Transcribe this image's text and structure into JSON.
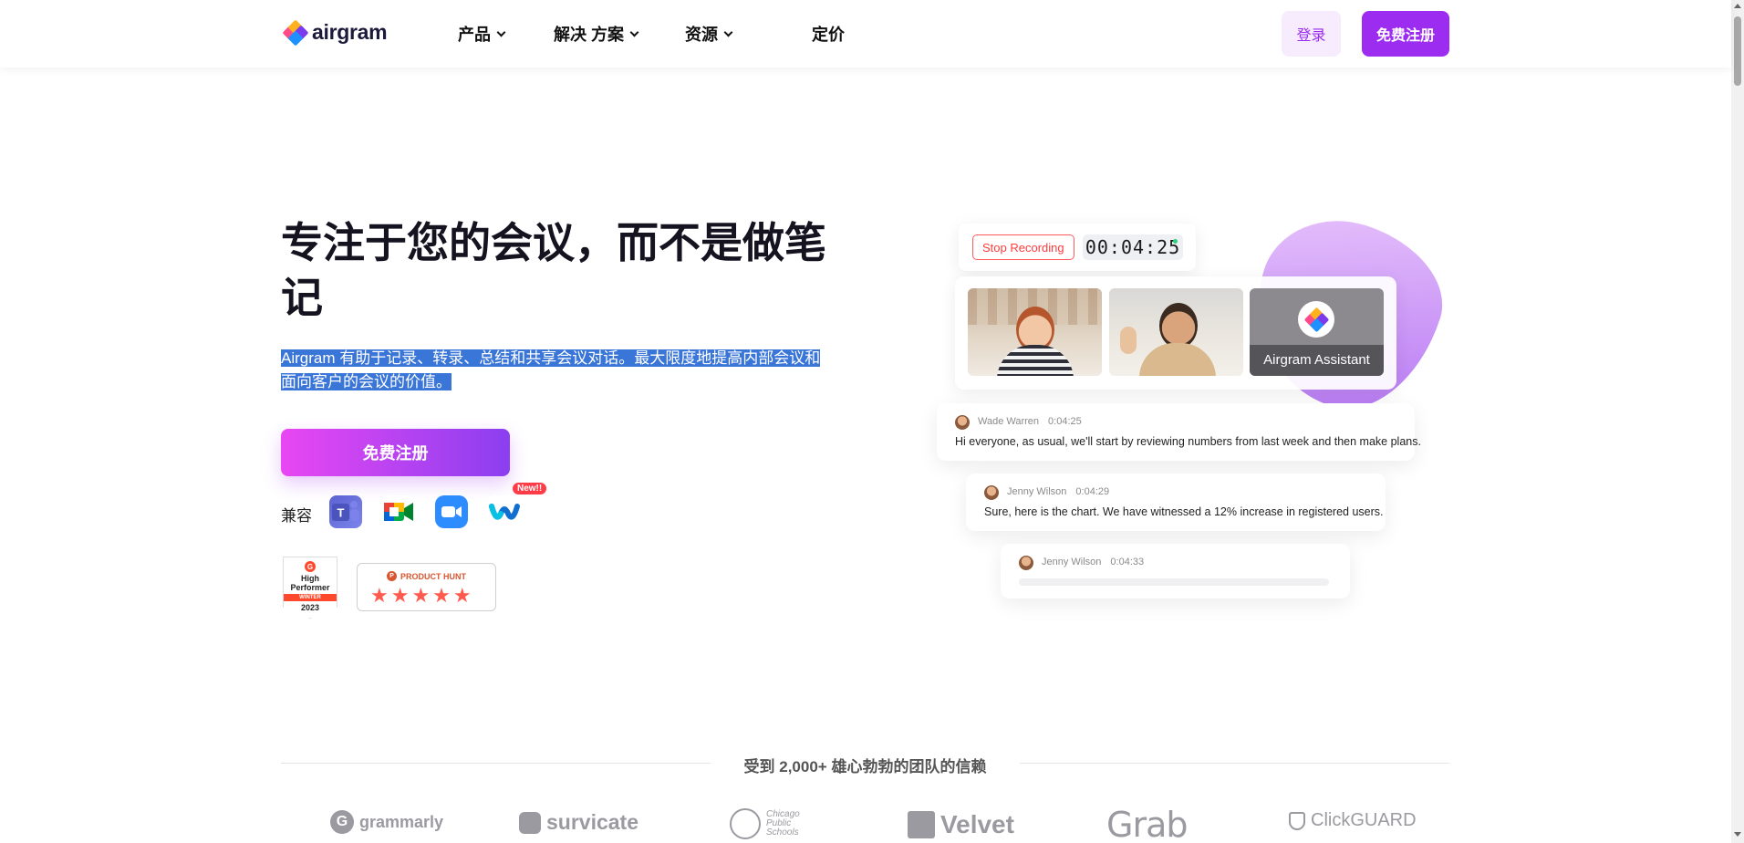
{
  "header": {
    "logo_text": "airgram",
    "nav": [
      {
        "label": "产品",
        "has_dropdown": true
      },
      {
        "label": "解决 方案",
        "has_dropdown": true
      },
      {
        "label": "资源",
        "has_dropdown": true
      },
      {
        "label": "定价",
        "has_dropdown": false
      }
    ],
    "login_label": "登录",
    "signup_label": "免费注册"
  },
  "hero": {
    "title": "专注于您的会议，而不是做笔记",
    "subtitle": "Airgram 有助于记录、转录、总结和共享会议对话。最大限度地提高内部会议和面向客户的会议的价值。",
    "subtitle_selected": true,
    "cta_label": "免费注册",
    "compat_label": "兼容",
    "apps": [
      "microsoft-teams-icon",
      "google-meet-icon",
      "zoom-icon",
      "webex-icon"
    ],
    "new_badge": "New!!"
  },
  "badges": {
    "g2": {
      "logo": "G",
      "line1": "High",
      "line2": "Performer",
      "season": "WINTER",
      "year": "2023"
    },
    "product_hunt": {
      "logo": "P",
      "label": "PRODUCT HUNT",
      "stars": 5
    }
  },
  "illustration": {
    "stop_recording_label": "Stop Recording",
    "timer": "00:04:25",
    "assistant_label": "Airgram Assistant",
    "messages": [
      {
        "name": "Wade Warren",
        "time": "0:04:25",
        "text": "Hi everyone, as usual, we'll start by reviewing numbers from last week and then make plans."
      },
      {
        "name": "Jenny Wilson",
        "time": "0:04:29",
        "text": "Sure, here is the chart. We have witnessed a 12% increase in registered users."
      },
      {
        "name": "Jenny Wilson",
        "time": "0:04:33",
        "text": ""
      }
    ]
  },
  "trust": {
    "text": "受到 2,000+ 雄心勃勃的团队的信赖",
    "brands": [
      "grammarly",
      "survicate",
      "Chicago Public Schools",
      "Velvet",
      "Grab",
      "ClickGUARD"
    ]
  },
  "colors": {
    "brand_purple": "#9b2cf0",
    "cta_gradient_start": "#e847f2",
    "cta_gradient_end": "#8b3ff0",
    "selection_blue": "#3a75d8",
    "recording_red": "#ff3b3b"
  }
}
